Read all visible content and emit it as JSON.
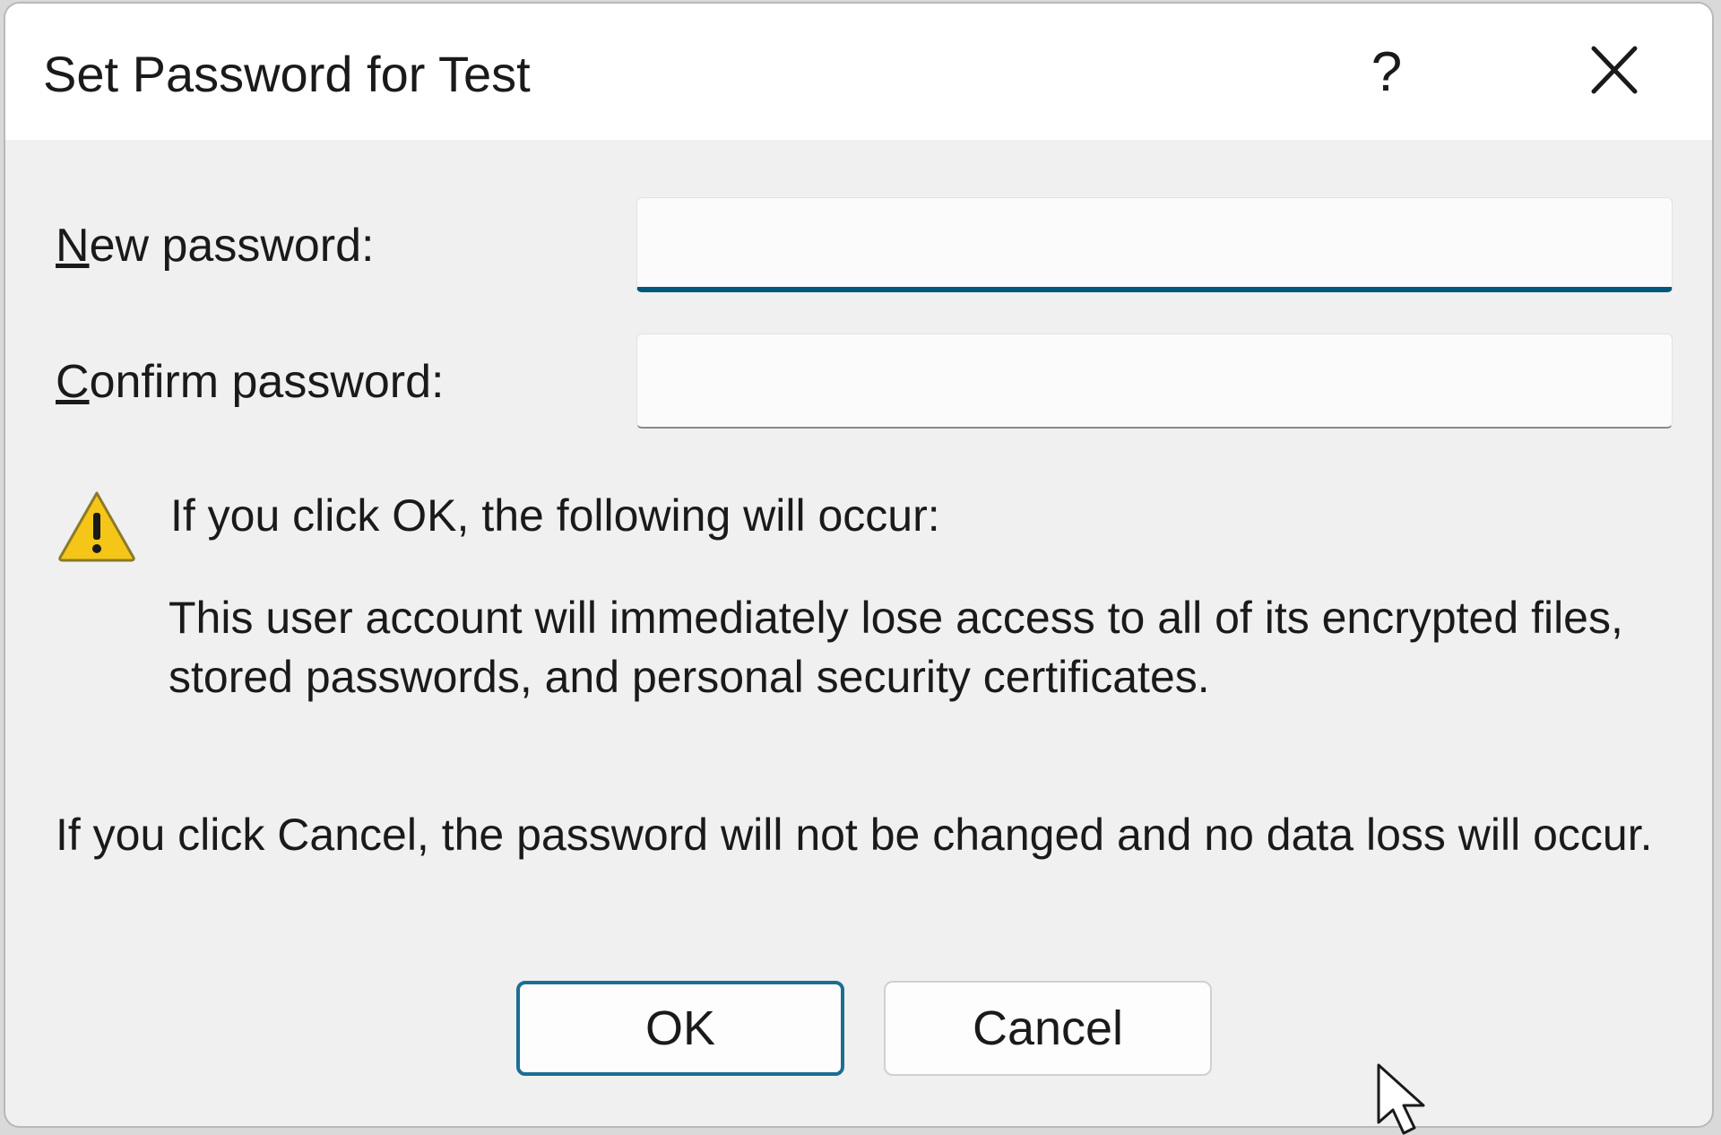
{
  "dialog": {
    "title": "Set Password for Test",
    "help_label": "?",
    "close_icon": "close-icon"
  },
  "form": {
    "new_password_label_accel": "N",
    "new_password_label_rest": "ew password:",
    "new_password_value": "",
    "confirm_password_label_accel": "C",
    "confirm_password_label_rest": "onfirm password:",
    "confirm_password_value": ""
  },
  "warning": {
    "icon": "warning-icon",
    "heading": "If you click OK, the following will occur:",
    "body": "This user account will immediately lose access to all of its encrypted files, stored passwords, and personal security certificates."
  },
  "cancel_note": "If you click Cancel, the password will not be changed and no data loss will occur.",
  "buttons": {
    "ok_label": "OK",
    "cancel_label": "Cancel"
  },
  "colors": {
    "focus_accent": "#00587a",
    "default_button_border": "#1c6e94",
    "warning_yellow": "#f5c518"
  }
}
